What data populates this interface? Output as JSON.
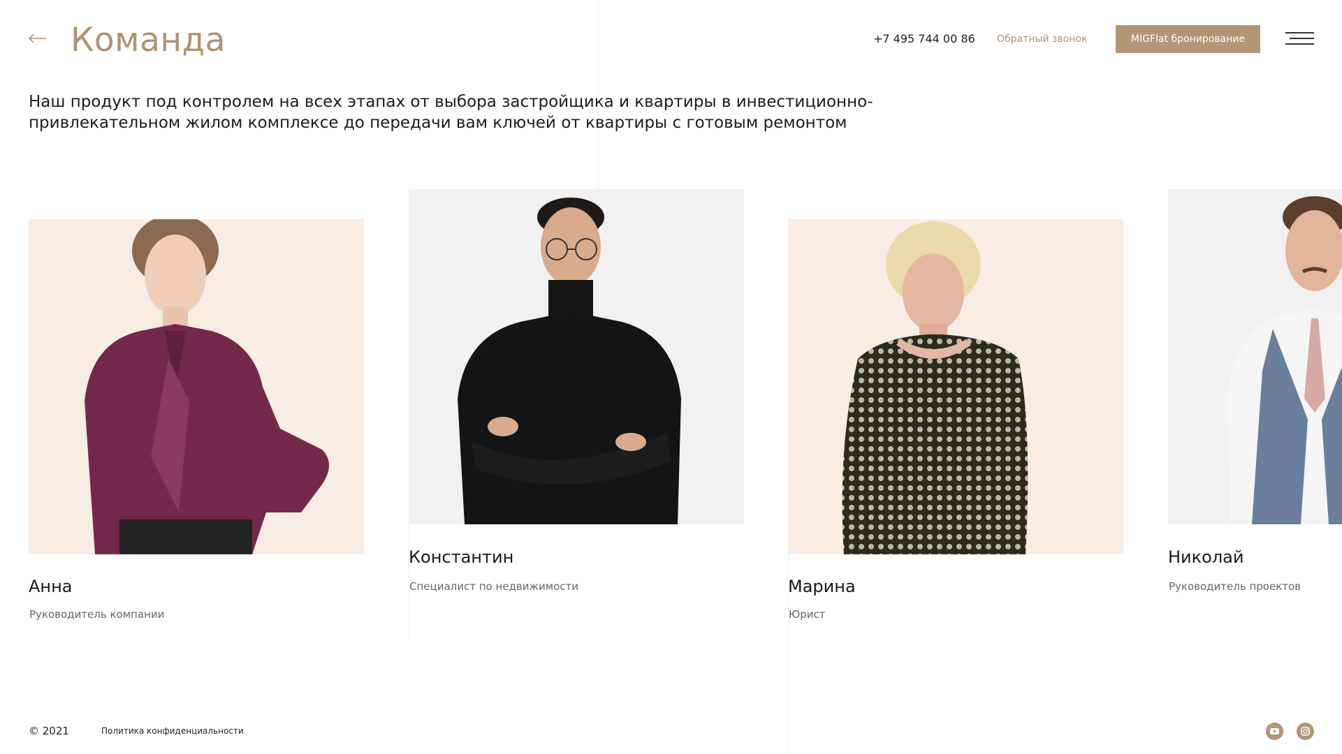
{
  "header": {
    "title": "Команда",
    "phone": "+7 495 744 00 86",
    "callback_label": "Обратный звонок",
    "cta_label": "MIGFlat бронирование"
  },
  "intro": {
    "text": "Наш продукт под контролем на всех этапах от выбора застройщика и квартиры в инвестиционно-привлекательном жилом комплексе до передачи вам ключей от квартиры с готовым ремонтом"
  },
  "team": [
    {
      "name": "Анна",
      "role": "Руководитель компании",
      "bg": "#f7ede5"
    },
    {
      "name": "Константин",
      "role": "Специалист по недвижимости",
      "bg": "#f1f1f1"
    },
    {
      "name": "Марина",
      "role": "Юрист",
      "bg": "#f7ede5"
    },
    {
      "name": "Николай",
      "role": "Руководитель проектов",
      "bg": "#f1f1f1"
    }
  ],
  "footer": {
    "copyright": "© 2021",
    "privacy_label": "Политика конфиденциальности"
  },
  "social": [
    "youtube-icon",
    "instagram-icon"
  ],
  "colors": {
    "accent": "#b29675",
    "title": "#ae9373"
  }
}
